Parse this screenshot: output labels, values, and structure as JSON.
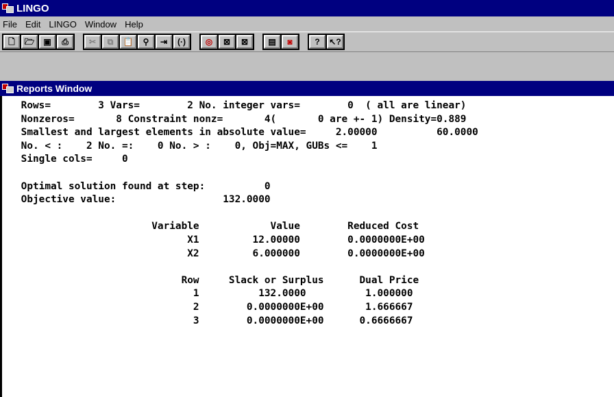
{
  "window": {
    "title": "LINGO"
  },
  "menu": [
    "File",
    "Edit",
    "LINGO",
    "Window",
    "Help"
  ],
  "toolbar": {
    "groups": [
      [
        {
          "icon": "new-file-icon",
          "glyph": "🗋"
        },
        {
          "icon": "open-folder-icon",
          "glyph": "🗁"
        },
        {
          "icon": "save-icon",
          "glyph": "▣"
        },
        {
          "icon": "print-icon",
          "glyph": "⎙"
        }
      ],
      [
        {
          "icon": "cut-icon",
          "glyph": "✂",
          "disabled": true
        },
        {
          "icon": "copy-icon",
          "glyph": "⧉",
          "disabled": true
        },
        {
          "icon": "paste-icon",
          "glyph": "📋",
          "disabled": true
        },
        {
          "icon": "find-icon",
          "glyph": "⚲"
        },
        {
          "icon": "goto-line-icon",
          "glyph": "⇥"
        },
        {
          "icon": "match-parenthesis-icon",
          "glyph": "(·)"
        }
      ],
      [
        {
          "icon": "solve-target-icon",
          "glyph": "◎",
          "red": true
        },
        {
          "icon": "solution-report-icon",
          "glyph": "⊠"
        },
        {
          "icon": "close-all-icon",
          "glyph": "⊠"
        }
      ],
      [
        {
          "icon": "tile-windows-icon",
          "glyph": "▤"
        },
        {
          "icon": "close-window-icon",
          "glyph": "◙",
          "red": true
        }
      ],
      [
        {
          "icon": "help-icon",
          "glyph": "?"
        },
        {
          "icon": "context-help-icon",
          "glyph": "↖?"
        }
      ]
    ]
  },
  "report_window": {
    "title": "Reports Window",
    "lines": [
      " Rows=        3 Vars=        2 No. integer vars=        0  ( all are linear)",
      " Nonzeros=       8 Constraint nonz=       4(       0 are +- 1) Density=0.889",
      " Smallest and largest elements in absolute value=     2.00000          60.0000",
      " No. < :    2 No. =:    0 No. > :    0, Obj=MAX, GUBs <=    1",
      " Single cols=     0",
      "",
      " Optimal solution found at step:          0",
      " Objective value:                  132.0000",
      "",
      "                       Variable            Value        Reduced Cost",
      "                             X1         12.00000        0.0000000E+00",
      "                             X2         6.000000        0.0000000E+00",
      "",
      "                            Row     Slack or Surplus      Dual Price",
      "                              1          132.0000          1.000000",
      "                              2        0.0000000E+00       1.666667",
      "                              3        0.0000000E+00      0.6666667"
    ]
  }
}
